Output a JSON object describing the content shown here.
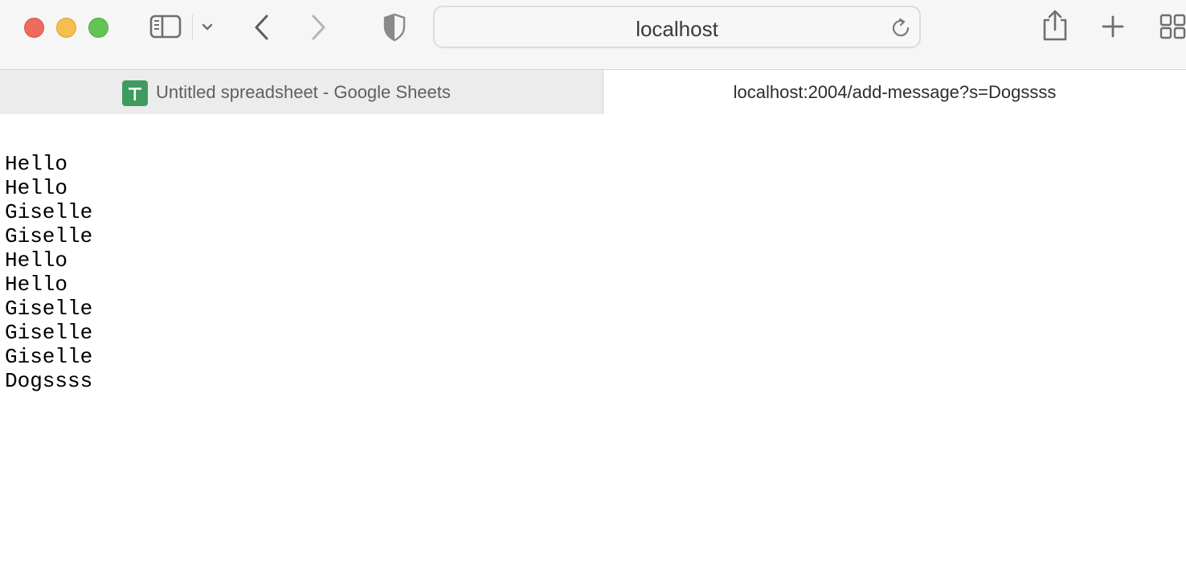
{
  "colors": {
    "close": "#ed6a5e",
    "minimize": "#f5bf4f",
    "maximize": "#61c554",
    "sheets_icon": "#3e9b5f"
  },
  "toolbar": {
    "sidebar_icon": "sidebar-icon",
    "sidebar_menu_icon": "chevron-down-icon",
    "back_icon": "chevron-left-icon",
    "forward_icon": "chevron-right-icon",
    "privacy_icon": "shield-icon",
    "address": "localhost",
    "reload_icon": "reload-icon",
    "share_icon": "share-icon",
    "new_tab_icon": "plus-icon",
    "tab_overview_icon": "grid-icon"
  },
  "tabs": [
    {
      "title": "Untitled spreadsheet - Google Sheets",
      "icon": "google-sheets-icon",
      "active": false
    },
    {
      "title": "localhost:2004/add-message?s=Dogssss",
      "active": true
    }
  ],
  "page": {
    "lines": [
      "Hello",
      "Hello",
      "Giselle",
      "Giselle",
      "Hello",
      "Hello",
      "Giselle",
      "Giselle",
      "Giselle",
      "Dogssss"
    ]
  }
}
